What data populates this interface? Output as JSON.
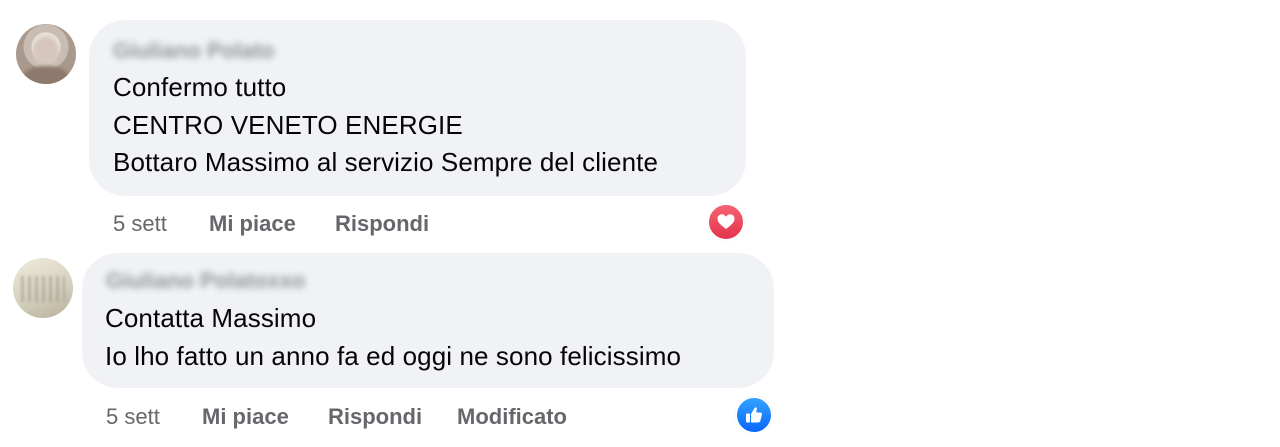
{
  "comments": [
    {
      "author": "Giuliano Polato",
      "lines": [
        "Confermo tutto",
        "CENTRO VENETO ENERGIE",
        "Bottaro Massimo al servizio Sempre del cliente"
      ],
      "time": "5 sett",
      "like_label": "Mi piace",
      "reply_label": "Rispondi",
      "reaction_icon": "heart-icon",
      "reaction_color": "#e4344b"
    },
    {
      "author": "Giuliano Polatoxxo",
      "lines": [
        "Contatta Massimo",
        "Io lho fatto un anno fa ed oggi ne sono felicissimo"
      ],
      "time": "5 sett",
      "like_label": "Mi piace",
      "reply_label": "Rispondi",
      "edited_label": "Modificato",
      "reaction_icon": "thumbs-up-icon",
      "reaction_color": "#0866ff"
    }
  ],
  "colors": {
    "bubble_bg": "#f0f2f5",
    "text": "#050505",
    "secondary_text": "#65676b"
  }
}
